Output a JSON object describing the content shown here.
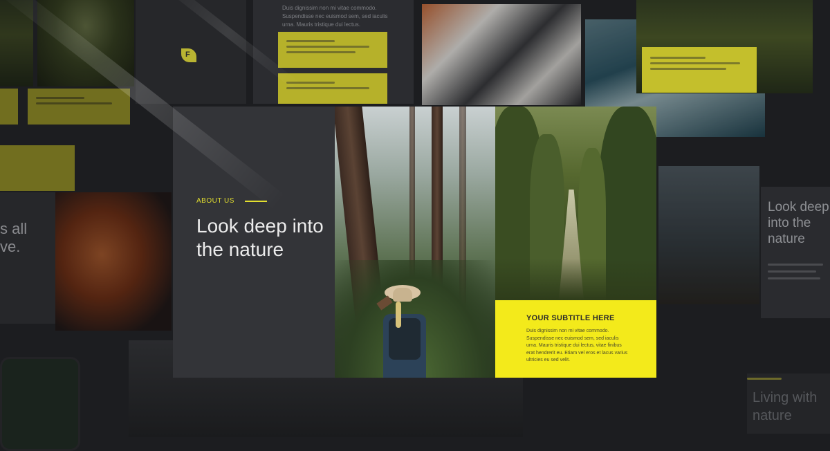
{
  "background": {
    "top_text_lines": [
      "Duis dignissim non mi vitae commodo.",
      "Suspendisse nec euismod sem, sed iaculis",
      "urna. Mauris tristique dui lectus."
    ],
    "logo_letter": "F",
    "right_heading": [
      "Look deep",
      "into the",
      "nature"
    ],
    "left_fragment": [
      "s all",
      "ve."
    ],
    "bottom_right_heading": [
      "Living with",
      "nature"
    ],
    "faded_subtitle": "YOUR SUBTITLE HERE"
  },
  "slide": {
    "section_label": "ABOUT US",
    "heading": "Look deep into the nature",
    "card": {
      "subtitle": "YOUR SUBTITLE HERE",
      "body": "Duis dignissim non mi vitae commodo. Suspendisse nec euismod sem, sed iaculis urna. Mauris tristique dui lectus, vitae finibus erat hendrerit eu. Etiam vel eros et lacus varius ultricies eu sed velit."
    }
  },
  "colors": {
    "accent_yellow": "#f3ea1b",
    "panel_dark": "#333438",
    "background": "#1c1d20"
  }
}
